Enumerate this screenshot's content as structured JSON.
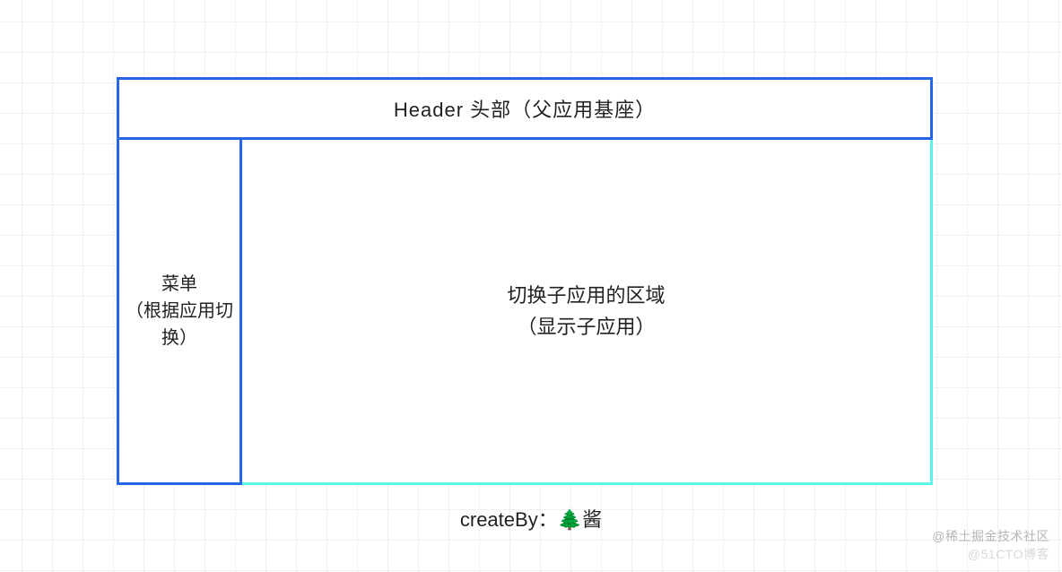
{
  "diagram": {
    "header": "Header 头部（父应用基座）",
    "sidebar": "菜单\n（根据应用切换）",
    "content": "切换子应用的区域\n（显示子应用）",
    "credit_label": "createBy：",
    "credit_icon": "🌲",
    "credit_suffix": "酱",
    "colors": {
      "parent_border": "#2767e6",
      "child_border": "#5ff5e8"
    }
  },
  "watermarks": {
    "line1": "@稀土掘金技术社区",
    "line2": "@51CTO博客"
  }
}
